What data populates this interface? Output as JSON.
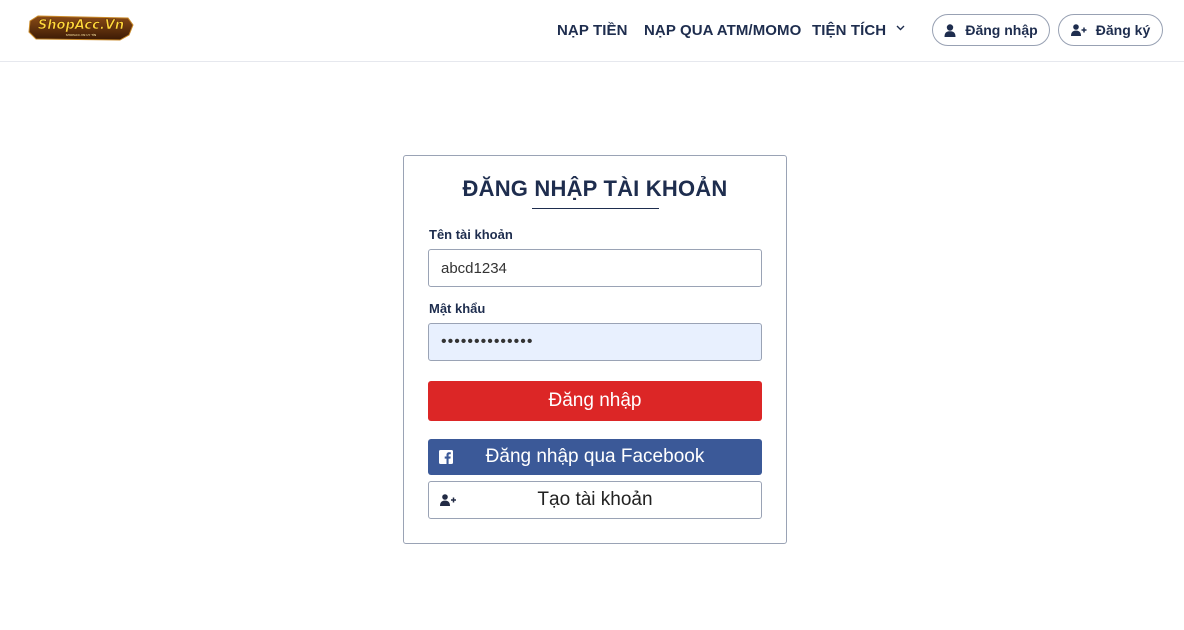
{
  "brand": {
    "logo_text": "ShopAcc.Vn",
    "logo_subtext": "SHOPACC.VN UY TÍN"
  },
  "nav": {
    "items": [
      {
        "label": "NẠP TIỀN"
      },
      {
        "label": "NẠP QUA ATM/MOMO"
      },
      {
        "label": "TIỆN TÍCH"
      }
    ]
  },
  "header_actions": {
    "login_label": "Đăng nhập",
    "register_label": "Đăng ký"
  },
  "login_form": {
    "title": "ĐĂNG NHẬP TÀI KHOẢN",
    "username_label": "Tên tài khoản",
    "username_value": "abcd1234",
    "password_label": "Mật khẩu",
    "password_value": "••••••••••••••",
    "submit_label": "Đăng nhập",
    "facebook_label": "Đăng nhập qua Facebook",
    "create_account_label": "Tạo tài khoản"
  },
  "icons": {
    "user": "user-icon",
    "user_plus": "user-plus-icon",
    "chevron": "chevron-down-icon",
    "facebook": "facebook-icon"
  },
  "colors": {
    "primary_text": "#1e2d4e",
    "login_button": "#dc2626",
    "facebook_button": "#3b5998",
    "autofill_bg": "#e8f0fe"
  }
}
